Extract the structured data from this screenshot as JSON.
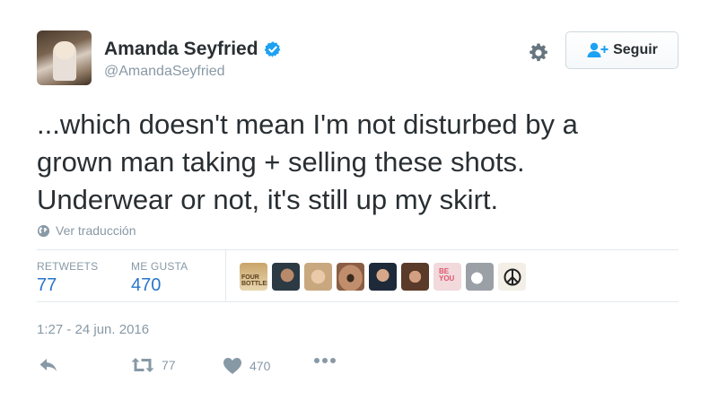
{
  "user": {
    "display_name": "Amanda Seyfried",
    "handle": "@AmandaSeyfried",
    "verified": true
  },
  "follow_button": {
    "label": "Seguir"
  },
  "tweet": {
    "lines": [
      "...which doesn't mean I'm not disturbed by a",
      "grown man taking + selling these shots.",
      "Underwear or not, it's still up my skirt."
    ],
    "translate_label": "Ver traducción",
    "timestamp": "1:27 - 24 jun. 2016"
  },
  "stats": {
    "retweets_label": "RETWEETS",
    "retweets_value": "77",
    "likes_label": "ME GUSTA",
    "likes_value": "470"
  },
  "likers": {
    "avatar_texts": [
      "FOUR BOTTLES",
      "BE YOU"
    ]
  },
  "actions": {
    "retweet_count": "77",
    "like_count": "470"
  },
  "colors": {
    "accent": "#2a75c8",
    "muted": "#8899a6",
    "verified": "#1da1f2"
  }
}
